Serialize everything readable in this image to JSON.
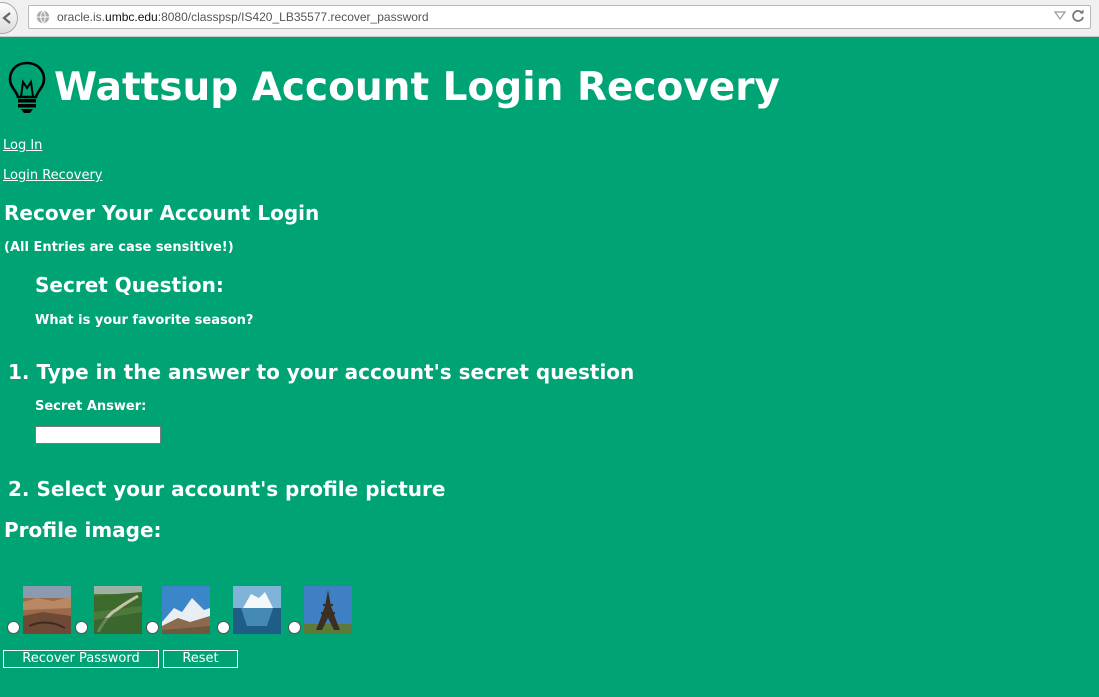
{
  "browser": {
    "url_prefix": "oracle.is.",
    "url_domain": "umbc.edu",
    "url_suffix": ":8080/classpsp/IS420_LB35577.recover_password"
  },
  "header": {
    "title": "Wattsup Account Login Recovery"
  },
  "nav": {
    "login_label": "Log In",
    "recovery_label": "Login Recovery"
  },
  "form": {
    "heading": "Recover Your Account Login",
    "note": "(All Entries are case sensitive!)",
    "question_heading": "Secret Question:",
    "question_text": "What is your favorite season?",
    "step1_heading": "1. Type in the answer to your account's secret question",
    "answer_label": "Secret Answer:",
    "answer_value": "",
    "step2_heading": "2. Select your account's profile picture",
    "profile_label": "Profile image:",
    "profile_images": [
      {
        "icon": "canyon-image"
      },
      {
        "icon": "great-wall-image"
      },
      {
        "icon": "mountain-image"
      },
      {
        "icon": "iceberg-image"
      },
      {
        "icon": "eiffel-tower-image"
      }
    ],
    "submit_label": "Recover Password",
    "reset_label": "Reset"
  },
  "colors": {
    "background": "#00a373",
    "text": "#ffffff"
  }
}
